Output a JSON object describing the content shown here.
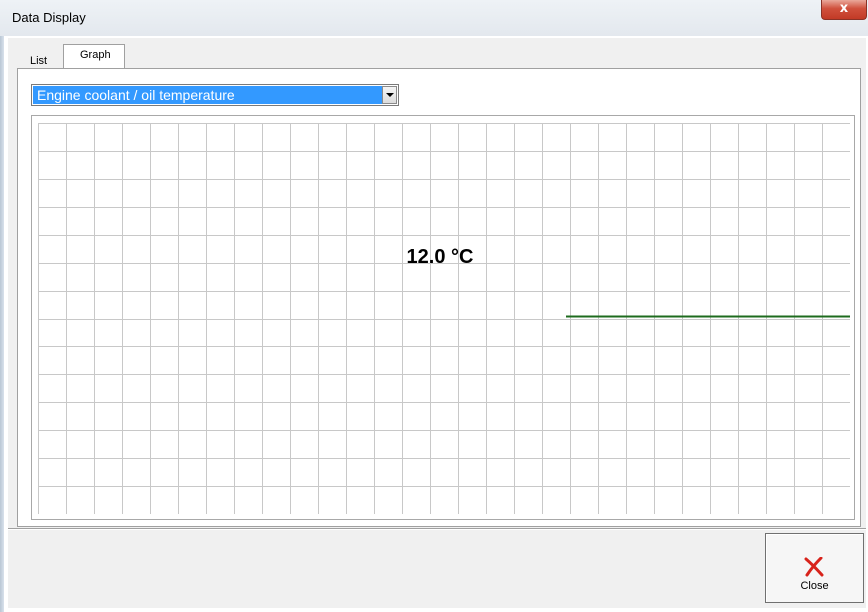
{
  "window": {
    "title": "Data Display",
    "close_glyph": "x"
  },
  "tabs": [
    {
      "label": "List",
      "active": false
    },
    {
      "label": "Graph",
      "active": true
    }
  ],
  "selector": {
    "selected": "Engine coolant / oil temperature",
    "arrow_icon": "chevron-down-icon"
  },
  "graph": {
    "readout": "12.0 °C",
    "grid": true,
    "grid_color": "#c8c8c8",
    "line_color": "#1e6b1e",
    "trace_level": 0.5
  },
  "actions": {
    "close_label": "Close",
    "close_icon": "close-x-icon",
    "close_icon_color": "#d8231b"
  }
}
